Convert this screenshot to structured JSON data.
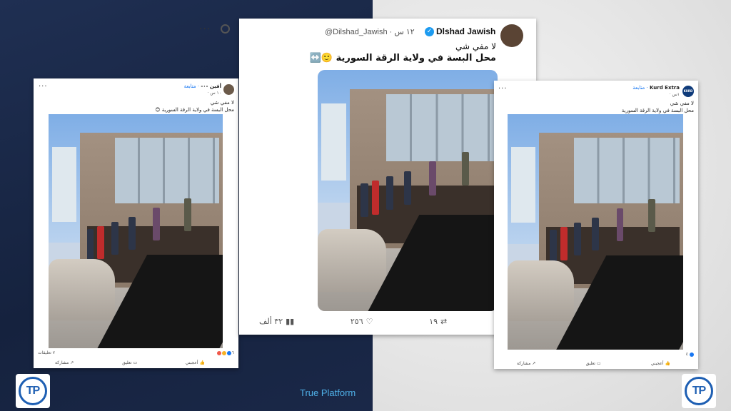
{
  "branding": {
    "footer_text": "True Platform",
    "logo_text": "TP"
  },
  "left_post": {
    "author": "أفين -٠-",
    "follow": "· متابعة",
    "time": "١٠ س ·",
    "line1": "لا مفي شي",
    "line2": "محل البسة في ولاية الرقة السورية 😊",
    "reaction_count": "٦",
    "comments_count": "٧ تعليقات",
    "like_label": "أعجبني",
    "comment_label": "تعليق",
    "share_label": "مشاركة"
  },
  "tweet": {
    "name": "Dlshad Jawish",
    "handle": "@Dilshad_Jawish · ١٢ س",
    "line1": "لا مفي شي",
    "line2": "محل البسة في ولاية الرقة السورية 🙂↔️",
    "views": "٣٢ ألف",
    "likes": "٢٥٦",
    "retweets": "١٩",
    "replies": "٣٩"
  },
  "right_post": {
    "author": "Kurd Extra",
    "follow": "· متابعة",
    "time": "١س ·",
    "avatar_text": "KURD",
    "line1": "لا مفي شي",
    "line2": "محل البسة في ولاية الرقة السورية",
    "reaction_count": "٤",
    "like_label": "أعجبني",
    "comment_label": "تعليق",
    "share_label": "مشاركة"
  },
  "colors": {
    "accent": "#1d9bf0",
    "navy": "#1c2a46",
    "brand_blue": "#1e5fb3"
  }
}
